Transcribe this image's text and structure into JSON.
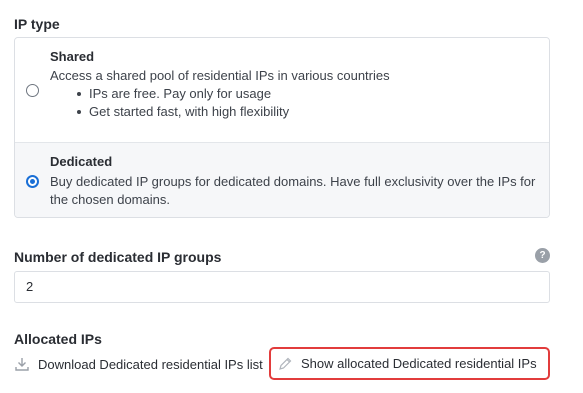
{
  "ip_type": {
    "label": "IP type",
    "options": [
      {
        "title": "Shared",
        "description": "Access a shared pool of residential IPs in various countries",
        "bullets": [
          "IPs are free. Pay only for usage",
          "Get started fast, with high flexibility"
        ],
        "selected": false
      },
      {
        "title": "Dedicated",
        "description": "Buy dedicated IP groups for dedicated domains. Have full exclusivity over the IPs for the chosen domains.",
        "selected": true
      }
    ]
  },
  "groups": {
    "label": "Number of dedicated IP groups",
    "help_icon": "question-icon",
    "help_glyph": "?",
    "value": "2"
  },
  "allocated": {
    "label": "Allocated IPs",
    "download_label": "Download Dedicated residential IPs list",
    "download_icon": "download-icon",
    "show_label": "Show allocated Dedicated residential IPs",
    "show_icon": "pencil-icon"
  },
  "colors": {
    "accent": "#1a6fd6",
    "highlight_border": "#e23c3c",
    "selected_bg": "#f6f7f9"
  }
}
